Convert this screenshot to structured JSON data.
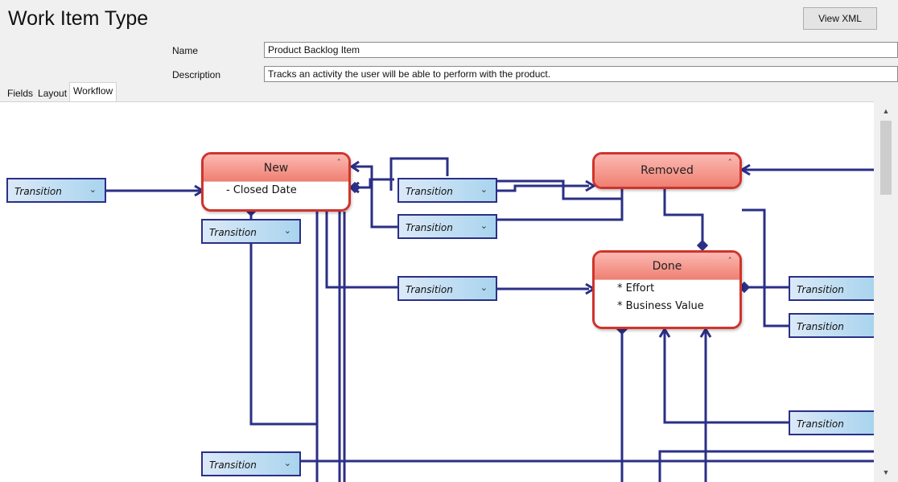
{
  "page": {
    "title": "Work Item Type",
    "view_xml_label": "View XML"
  },
  "form": {
    "name_label": "Name",
    "name_value": "Product Backlog Item",
    "description_label": "Description",
    "description_value": "Tracks an activity the user will be able to perform with the product."
  },
  "tabs": [
    {
      "label": "Fields",
      "active": false
    },
    {
      "label": "Layout",
      "active": false
    },
    {
      "label": "Workflow",
      "active": true
    }
  ],
  "workflow": {
    "states": {
      "new": {
        "name": "New",
        "fields": [
          "- Closed Date"
        ]
      },
      "removed": {
        "name": "Removed",
        "fields": []
      },
      "done": {
        "name": "Done",
        "fields": [
          "* Effort",
          "* Business Value"
        ]
      }
    },
    "transition_label": "Transition",
    "expand_glyph": "»",
    "collapse_glyph": "«"
  },
  "colors": {
    "connector": "#2b2f86",
    "state_border": "#d0342c",
    "state_header": "#f07f72",
    "transition_fill": "#a9d4ee"
  },
  "icons": {
    "collapse": "collapse-icon",
    "expand": "expand-icon",
    "scroll_up": "scroll-up-arrow-icon",
    "scroll_down": "scroll-down-arrow-icon"
  }
}
